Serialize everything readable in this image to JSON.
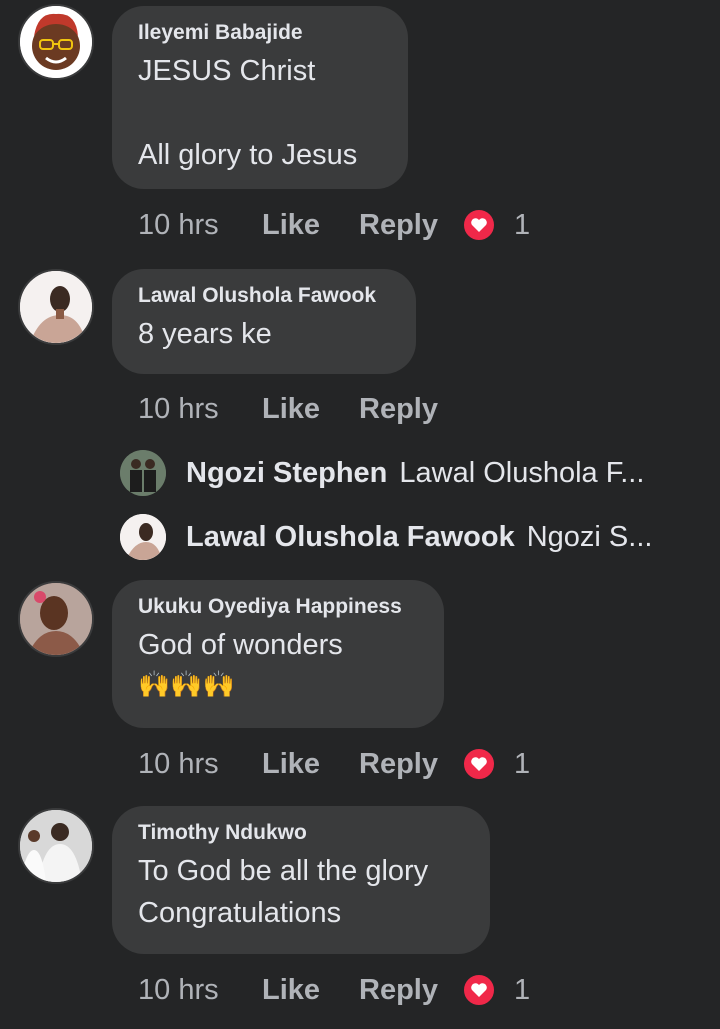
{
  "comments": [
    {
      "author": "Ileyemi Babajide",
      "text": "JESUS Christ\n\nAll glory to Jesus",
      "time": "10 hrs",
      "like": "Like",
      "reply": "Reply",
      "reaction": "heart",
      "reaction_count": "1"
    },
    {
      "author": "Lawal Olushola Fawook",
      "text": "8 years ke",
      "time": "10 hrs",
      "like": "Like",
      "reply": "Reply",
      "replies": [
        {
          "author": "Ngozi Stephen",
          "preview": "Lawal Olushola F..."
        },
        {
          "author": "Lawal Olushola Fawook",
          "preview": "Ngozi S..."
        }
      ]
    },
    {
      "author": "Ukuku Oyediya Happiness",
      "text": "God of wonders",
      "emoji": "🙌🙌🙌",
      "time": "10 hrs",
      "like": "Like",
      "reply": "Reply",
      "reaction": "heart",
      "reaction_count": "1"
    },
    {
      "author": "Timothy Ndukwo",
      "text": "To God be all the glory\nCongratulations",
      "time": "10 hrs",
      "like": "Like",
      "reply": "Reply",
      "reaction": "heart",
      "reaction_count": "1"
    }
  ],
  "colors": {
    "background": "#242526",
    "bubble": "#3a3b3c",
    "heart": "#f02849"
  }
}
